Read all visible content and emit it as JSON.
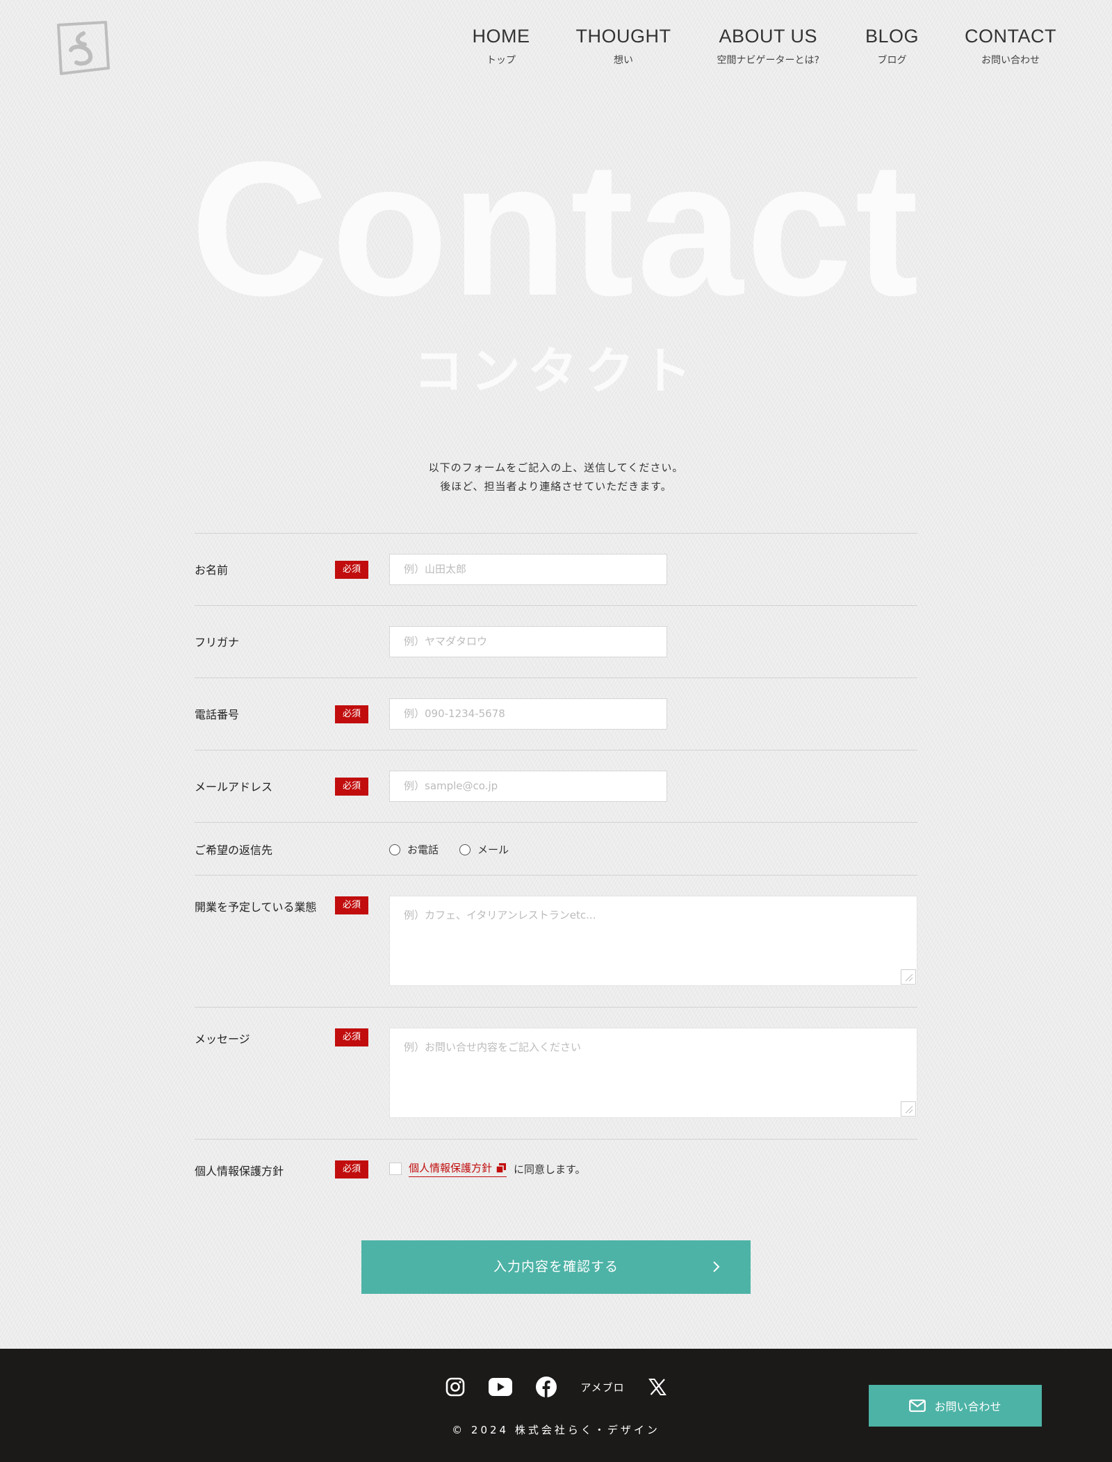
{
  "nav": {
    "items": [
      {
        "en": "HOME",
        "ja": "トップ"
      },
      {
        "en": "THOUGHT",
        "ja": "想い"
      },
      {
        "en": "ABOUT US",
        "ja": "空間ナビゲーターとは?"
      },
      {
        "en": "BLOG",
        "ja": "ブログ"
      },
      {
        "en": "CONTACT",
        "ja": "お問い合わせ"
      }
    ]
  },
  "hero": {
    "title": "Contact",
    "subtitle": "コンタクト"
  },
  "intro": {
    "line1": "以下のフォームをご記入の上、送信してください。",
    "line2": "後ほど、担当者より連絡させていただきます。"
  },
  "form": {
    "required_label": "必須",
    "name": {
      "label": "お名前",
      "placeholder": "例）山田太郎"
    },
    "furigana": {
      "label": "フリガナ",
      "placeholder": "例）ヤマダタロウ"
    },
    "phone": {
      "label": "電話番号",
      "placeholder": "例）090-1234-5678"
    },
    "email": {
      "label": "メールアドレス",
      "placeholder": "例）sample@co.jp"
    },
    "reply": {
      "label": "ご希望の返信先",
      "options": [
        "お電話",
        "メール"
      ]
    },
    "business": {
      "label": "開業を予定している業態",
      "placeholder": "例）カフェ、イタリアンレストランetc..."
    },
    "message": {
      "label": "メッセージ",
      "placeholder": "例）お問い合せ内容をご記入ください"
    },
    "privacy": {
      "label": "個人情報保護方針",
      "link": "個人情報保護方針",
      "suffix": "に同意します。"
    },
    "submit": "入力内容を確認する"
  },
  "footer": {
    "ameblo": "アメブロ",
    "copyright": "© 2024 株式会社らく・デザイン",
    "contact_button": "お問い合わせ"
  },
  "colors": {
    "accent": "#4db3a6",
    "required": "#c10d0d",
    "footer_bg": "#1c1a19"
  }
}
